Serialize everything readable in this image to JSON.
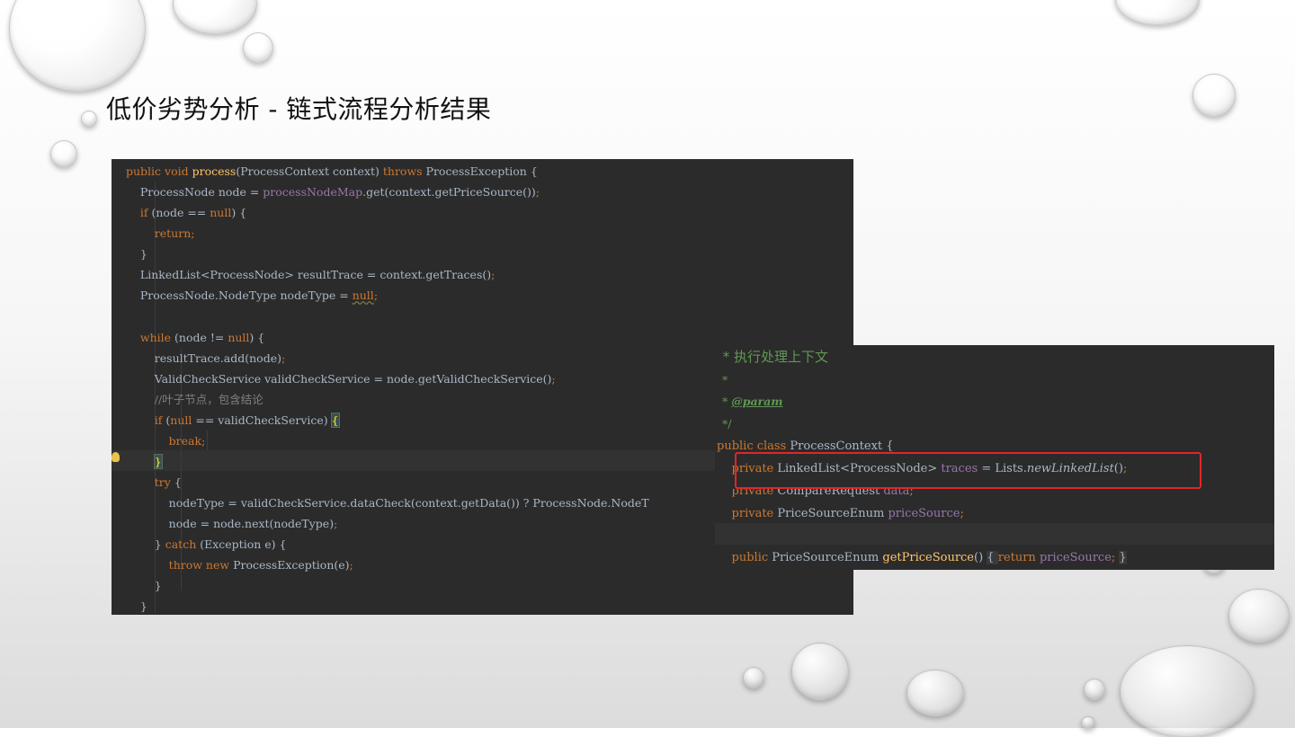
{
  "slide": {
    "title": "低价劣势分析 - 链式流程分析结果"
  },
  "code_left": {
    "lines": {
      "l1_a": "public void ",
      "l1_fn": "process",
      "l1_b": "(ProcessContext context) ",
      "l1_k": "throws ",
      "l1_c": "ProcessException {",
      "l2_a": "    ProcessNode node = ",
      "l2_f": "processNodeMap",
      "l2_b": ".get(context.getPriceSource())",
      "l2_k": ";",
      "l3_k1": "    if ",
      "l3_a": "(node == ",
      "l3_k2": "null",
      "l3_b": ") {",
      "l4_k": "        return;",
      "l5": "    }",
      "l6_a": "    LinkedList<ProcessNode> resultTrace = context.getTraces()",
      "l6_k": ";",
      "l7_a": "    ProcessNode.NodeType nodeType = ",
      "l7_u": "null",
      "l7_k": ";",
      "l9_k1": "    while ",
      "l9_a": "(node != ",
      "l9_k2": "null",
      "l9_b": ") {",
      "l10_a": "        resultTrace.add(node)",
      "l10_k": ";",
      "l11_a": "        ValidCheckService validCheckService = node.getValidCheckService()",
      "l11_k": ";",
      "l12_cm": "        //叶子节点，包含结论",
      "l13_k1": "        if ",
      "l13_a": "(",
      "l13_k2": "null",
      "l13_b": " == validCheckService) ",
      "l13_br": "{",
      "l14_k": "            break;",
      "l15_sp": "        ",
      "l15_br": "}",
      "l16_k": "        try ",
      "l16_a": "{",
      "l17_a": "            nodeType = validCheckService.dataCheck(context.getData()) ? ProcessNode.NodeT",
      "l18_a": "            node = node.next(nodeType)",
      "l18_k": ";",
      "l19_a": "        } ",
      "l19_k": "catch ",
      "l19_b": "(Exception e) {",
      "l20_k": "            throw new ",
      "l20_a": "ProcessException(e)",
      "l20_k2": ";",
      "l21": "        }",
      "l22": "    }"
    }
  },
  "code_right": {
    "lines": {
      "r1": " * 执行处理上下文",
      "r2": " *",
      "r3_a": " * ",
      "r3_tag": "@param",
      "r4": " */",
      "r5_k": "public class ",
      "r5_a": "ProcessContext {",
      "r6_k": "    private ",
      "r6_a": "LinkedList<ProcessNode> ",
      "r6_f": "traces",
      "r6_b": " = Lists.",
      "r6_it": "newLinkedList",
      "r6_c": "()",
      "r6_k2": ";",
      "r7_k": "    private ",
      "r7_a": "CompareRequest ",
      "r7_f": "data",
      "r7_k2": ";",
      "r8_k": "    private ",
      "r8_a": "PriceSourceEnum ",
      "r8_f": "priceSource",
      "r8_k2": ";",
      "r10_k": "    public ",
      "r10_a": "PriceSourceEnum ",
      "r10_fn": "getPriceSource",
      "r10_b": "() ",
      "r10_br1": "{ ",
      "r10_k2": "return ",
      "r10_f": "priceSource",
      "r10_k3": "; ",
      "r10_br2": "}"
    }
  },
  "colors": {
    "editor_bg": "#2b2b2b",
    "keyword": "#cc7832",
    "function": "#ffc66d",
    "field": "#9876aa",
    "doc_comment": "#629755",
    "highlight_box": "#e0262a"
  }
}
